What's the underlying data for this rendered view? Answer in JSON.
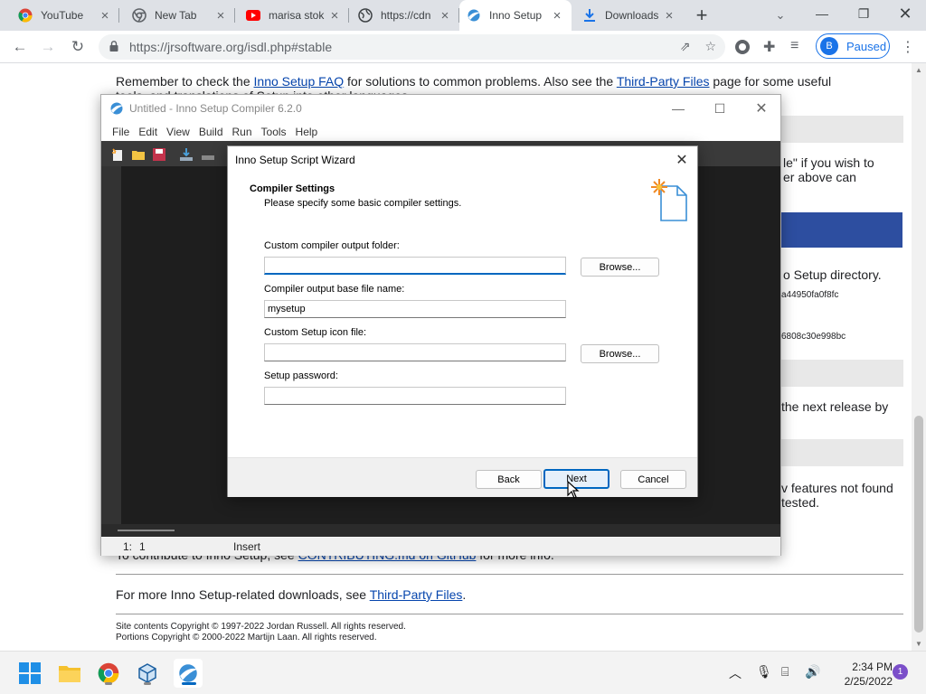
{
  "browser": {
    "tabs": [
      {
        "title": "YouTube",
        "icon": "chrome-icon"
      },
      {
        "title": "New Tab",
        "icon": "chrome-icon"
      },
      {
        "title": "marisa stok",
        "icon": "youtube-icon"
      },
      {
        "title": "https://cdn",
        "icon": "globe-icon"
      },
      {
        "title": "Inno Setup",
        "icon": "inno-setup-icon",
        "active": true
      },
      {
        "title": "Downloads",
        "icon": "download-icon"
      }
    ],
    "url": "https://jrsoftware.org/isdl.php#stable",
    "profile_initial": "B",
    "profile_status": "Paused"
  },
  "webpage": {
    "line1_pre": "Remember to check the ",
    "line1_link1": "Inno Setup FAQ",
    "line1_mid": " for solutions to common problems. Also see the ",
    "line1_link2": "Third-Party Files",
    "line1_post": " page for some useful",
    "line2": "tools, and translations of Setup into other languages.",
    "right1": "le\" if you wish to",
    "right2": "er above can",
    "right3": "o Setup directory.",
    "hash1": "a44950fa0f8fc",
    "hash2": "6808c30e998bc",
    "right4": "the next release by",
    "right5": "v features not found",
    "right6": "tested.",
    "contrib_pre": "To contribute to Inno Setup, see ",
    "contrib_link": "CONTRIBUTING.md on GitHub",
    "contrib_post": " for more info.",
    "more_pre": "For more Inno Setup-related downloads, see ",
    "more_link": "Third-Party Files",
    "more_post": ".",
    "copyright1": "Site contents Copyright © 1997-2022 Jordan Russell. All rights reserved.",
    "copyright2": "Portions Copyright © 2000-2022 Martijn Laan. All rights reserved."
  },
  "compiler": {
    "title": "Untitled - Inno Setup Compiler 6.2.0",
    "menu": [
      "File",
      "Edit",
      "View",
      "Build",
      "Run",
      "Tools",
      "Help"
    ],
    "status_line": "1:",
    "status_col": "1",
    "status_mode": "Insert"
  },
  "wizard": {
    "title": "Inno Setup Script Wizard",
    "heading": "Compiler Settings",
    "subheading": "Please specify some basic compiler settings.",
    "output_folder_label": "Custom compiler output folder:",
    "output_folder_value": "",
    "base_name_label": "Compiler output base file name:",
    "base_name_value": "mysetup",
    "icon_file_label": "Custom Setup icon file:",
    "icon_file_value": "",
    "password_label": "Setup password:",
    "password_value": "",
    "browse_label": "Browse...",
    "back_label": "Back",
    "next_label": "Next",
    "cancel_label": "Cancel"
  },
  "taskbar": {
    "time": "2:34 PM",
    "date": "2/25/2022",
    "notification_count": "1"
  },
  "colors": {
    "accent": "#0067c0",
    "link": "#0645ad",
    "editor_bg": "#1e1e1e",
    "chrome_blue": "#1a73e8"
  }
}
